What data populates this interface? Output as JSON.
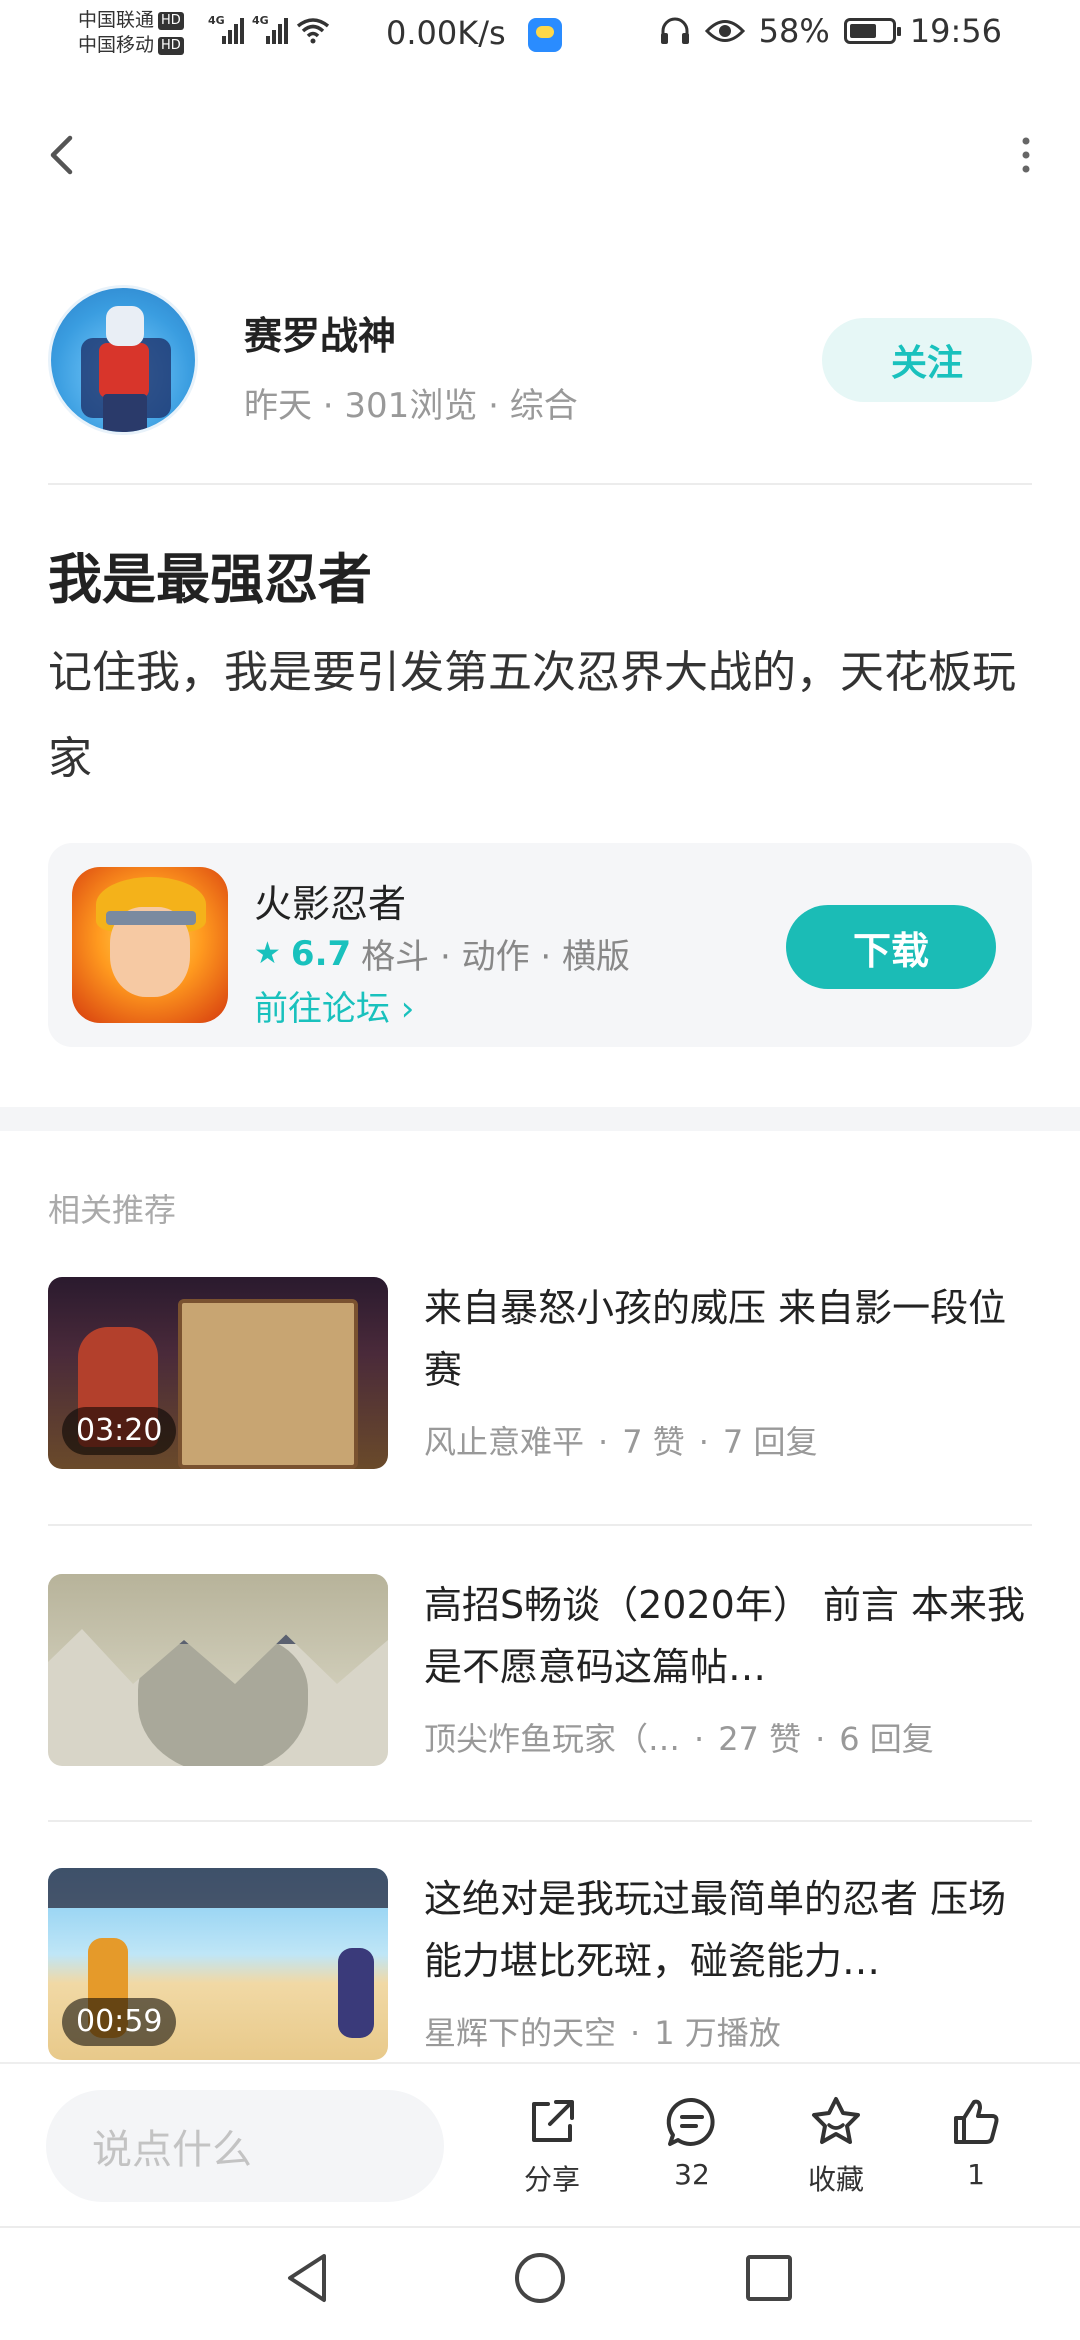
{
  "status_bar": {
    "carrier1": "中国联通",
    "carrier2": "中国移动",
    "hd": "HD",
    "net": "4G",
    "speed": "0.00K/s",
    "battery": "58%",
    "time": "19:56"
  },
  "author": {
    "name": "赛罗战神",
    "meta": "昨天 · 301浏览 · 综合",
    "follow_label": "关注"
  },
  "post": {
    "title": "我是最强忍者",
    "body": "记住我，我是要引发第五次忍界大战的，天花板玩家"
  },
  "game": {
    "name": "火影忍者",
    "rating": "6.7",
    "tags": "格斗 · 动作 · 横版",
    "forum_link": "前往论坛 ›",
    "download_label": "下载"
  },
  "related": {
    "label": "相关推荐",
    "items": [
      {
        "title": "来自暴怒小孩的威压 来自影一段位赛",
        "author": "风止意难平",
        "stat1": "7 赞",
        "stat2": "7 回复",
        "duration": "03:20"
      },
      {
        "title": "高招S畅谈（2020年） 前言 本来我是不愿意码这篇帖…",
        "author": "顶尖炸鱼玩家（…",
        "stat1": "27 赞",
        "stat2": "6 回复",
        "duration": ""
      },
      {
        "title": "这绝对是我玩过最简单的忍者 压场能力堪比死斑，碰瓷能力…",
        "author": "星辉下的天空",
        "stat1": "1 万播放",
        "stat2": "",
        "duration": "00:59"
      }
    ]
  },
  "actions": {
    "comment_placeholder": "说点什么",
    "share_label": "分享",
    "comments_count": "32",
    "favorite_label": "收藏",
    "likes_count": "1"
  },
  "colors": {
    "accent": "#1bbcb6",
    "accent_light": "#e6f7f6",
    "muted_text": "#999999"
  }
}
